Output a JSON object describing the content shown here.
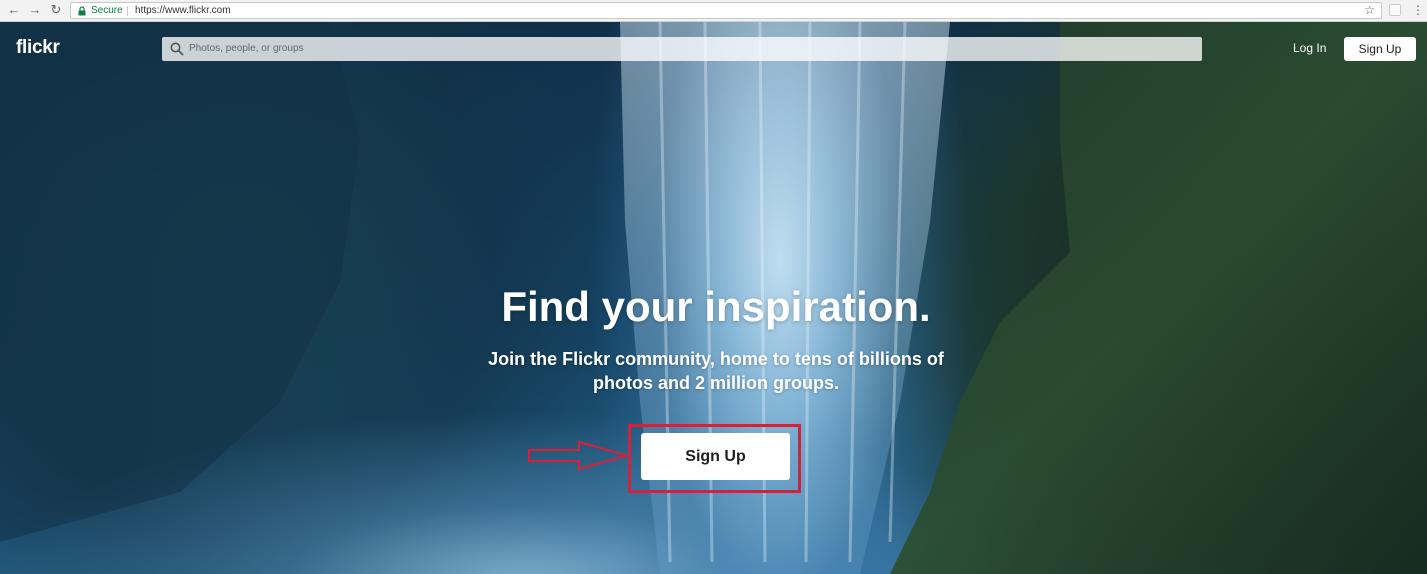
{
  "browser": {
    "secure_label": "Secure",
    "url": "https://www.flickr.com",
    "icons": [
      "back-icon",
      "forward-icon",
      "reload-icon",
      "lock-icon",
      "star-icon",
      "extension-icon",
      "menu-icon"
    ]
  },
  "header": {
    "logo": "flickr",
    "search_placeholder": "Photos, people, or groups",
    "login_label": "Log In",
    "signup_label": "Sign Up"
  },
  "hero": {
    "headline": "Find your inspiration.",
    "subline": "Join the Flickr community, home to tens of billions of photos and 2 million groups.",
    "cta_label": "Sign Up"
  },
  "colors": {
    "highlight": "#d6213a",
    "secure_green": "#0b8043",
    "button_text": "#212124"
  }
}
